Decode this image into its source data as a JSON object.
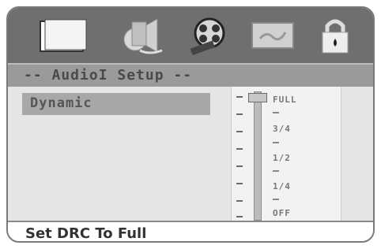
{
  "icon_bar": {
    "tabs": [
      {
        "icon": "screen-icon"
      },
      {
        "icon": "speaker-icon"
      },
      {
        "icon": "film-reel-icon"
      },
      {
        "icon": "preference-icon"
      },
      {
        "icon": "lock-icon"
      }
    ],
    "active_tab": "speaker-icon"
  },
  "title_bar": {
    "title": "-- AudioI Setup --"
  },
  "menu": {
    "items": [
      {
        "label": "Dynamic"
      }
    ]
  },
  "slider": {
    "levels": [
      "FULL",
      "3/4",
      "1/2",
      "1/4",
      "OFF"
    ],
    "selected": "FULL",
    "value_fraction": 1.0
  },
  "status": {
    "text": "Set DRC To Full"
  },
  "colors": {
    "frame_border": "#7a7a7a",
    "icon_bar_bg": "#6f6f6f",
    "title_bar_bg": "#9a9a9a",
    "menu_highlight": "#a8a8a8",
    "content_bg": "#e6e6e6"
  }
}
